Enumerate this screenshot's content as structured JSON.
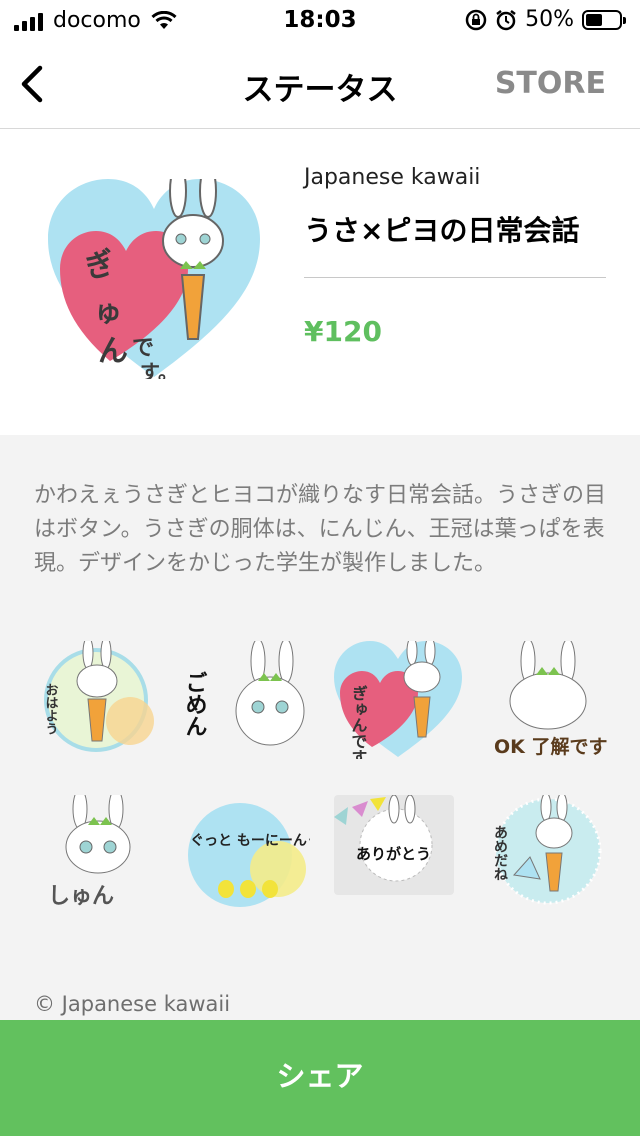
{
  "status_bar": {
    "carrier": "docomo",
    "time": "18:03",
    "battery": "50%"
  },
  "nav": {
    "title": "ステータス",
    "store_label": "STORE"
  },
  "product": {
    "author": "Japanese kawaii",
    "title": "うさ×ピヨの日常会話",
    "price": "¥120"
  },
  "description": "かわえぇうさぎとヒヨコが織りなす日常会話。うさぎの目はボタン。うさぎの胴体は、にんじん、王冠は葉っぱを表現。デザインをかじった学生が製作しました。",
  "stickers": [
    {
      "text": "おはよう"
    },
    {
      "text": "ごめん"
    },
    {
      "text": "ぎゅんです。"
    },
    {
      "text": "OK 了解です"
    },
    {
      "text": "しゅん"
    },
    {
      "text": "ぐっと もーにーんぐ"
    },
    {
      "text": "ありがとう"
    },
    {
      "text": "あめだね"
    }
  ],
  "copyright": "© Japanese kawaii",
  "share_label": "シェア",
  "colors": {
    "accent_green": "#62c15e",
    "price_green": "#5fbf5f",
    "store_gray": "#8a8a8a"
  }
}
